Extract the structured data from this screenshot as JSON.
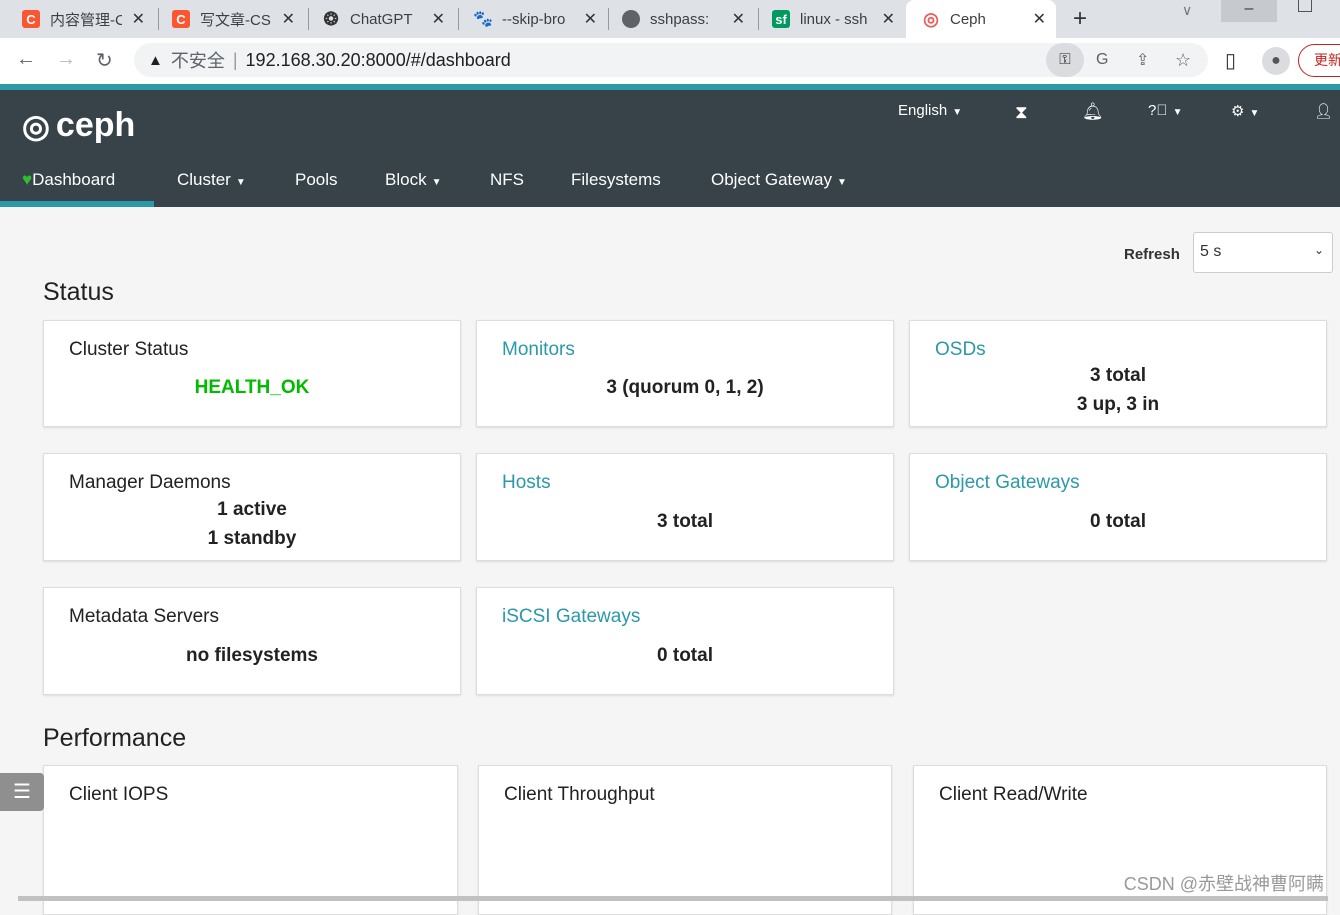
{
  "browser": {
    "tabs": [
      {
        "title": "内容管理-C",
        "icon": "csdn-icon",
        "color": "#fc5531"
      },
      {
        "title": "写文章-CS",
        "icon": "csdn-icon",
        "color": "#fc5531"
      },
      {
        "title": "ChatGPT",
        "icon": "openai-icon",
        "color": "#333333"
      },
      {
        "title": "--skip-bro",
        "icon": "baidu-icon",
        "color": "#2932e1"
      },
      {
        "title": "sshpass:",
        "icon": "globe-icon",
        "color": "#5f6368"
      },
      {
        "title": "linux - ssh",
        "icon": "sf-icon",
        "color": "#009a61"
      },
      {
        "title": "Ceph",
        "icon": "ceph-icon",
        "color": "#ef5c55"
      }
    ],
    "security": "不安全",
    "url": "192.168.30.20:8000/#/dashboard",
    "update": "更新"
  },
  "header": {
    "logo": "ceph",
    "language": "English",
    "nav": [
      "Dashboard",
      "Cluster",
      "Pools",
      "Block",
      "NFS",
      "Filesystems",
      "Object Gateway"
    ]
  },
  "refresh": {
    "label": "Refresh",
    "value": "5 s"
  },
  "status": {
    "title": "Status",
    "cards": [
      {
        "title": "Cluster Status",
        "lines": [
          "HEALTH_OK"
        ]
      },
      {
        "title": "Monitors",
        "lines": [
          "3 (quorum 0, 1, 2)"
        ]
      },
      {
        "title": "OSDs",
        "lines": [
          "3 total",
          "3 up, 3 in"
        ]
      },
      {
        "title": "Manager Daemons",
        "lines": [
          "1 active",
          "1 standby"
        ]
      },
      {
        "title": "Hosts",
        "lines": [
          "3 total"
        ]
      },
      {
        "title": "Object Gateways",
        "lines": [
          "0 total"
        ]
      },
      {
        "title": "Metadata Servers",
        "lines": [
          "no filesystems"
        ]
      },
      {
        "title": "iSCSI Gateways",
        "lines": [
          "0 total"
        ]
      }
    ]
  },
  "performance": {
    "title": "Performance",
    "cards": [
      "Client IOPS",
      "Client Throughput",
      "Client Read/Write"
    ]
  },
  "colors": {
    "accent": "#2b99a8",
    "health_ok": "#00bb00",
    "header": "#374249"
  },
  "watermark": "CSDN @赤壁战神曹阿瞒"
}
